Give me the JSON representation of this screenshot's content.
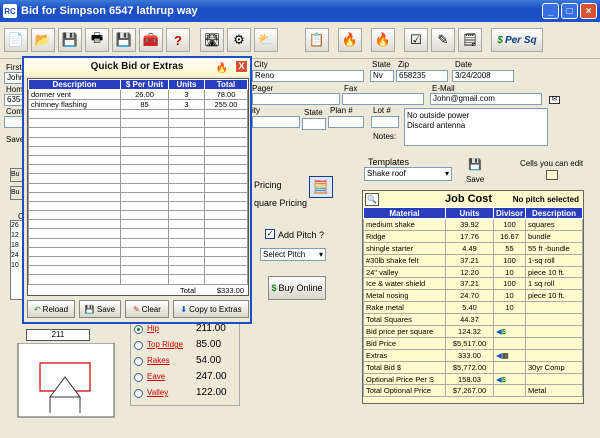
{
  "window": {
    "title": "Bid for Simpson 6547 lathrup way",
    "app_icon": "RC",
    "min_label": "_",
    "max_label": "□",
    "close_label": "×"
  },
  "toolbar": {
    "persq_label": "Per Sq"
  },
  "customer": {
    "city_label": "City",
    "city": "Reno",
    "state_label": "State",
    "state": "Nv",
    "zip_label": "Zip",
    "zip": "658235",
    "date_label": "Date",
    "date": "3/24/2008",
    "pager_label": "Pager",
    "fax_label": "Fax",
    "email_label": "E-Mail",
    "email": "John@gmail.com",
    "city2_label": "ity",
    "state2_label": "State",
    "plan_label": "Plan #",
    "lot_label": "Lot #",
    "notes_label": "Notes:",
    "notes_line1": "No outside power",
    "notes_line2": "Discard antenna",
    "left_first": "First",
    "left_john": "John",
    "left_hom": "Hom",
    "left_635": "635-",
    "left_com": "Com",
    "left_save": "Save"
  },
  "quick_bid": {
    "title": "Quick Bid or Extras",
    "close_label": "X",
    "headers": [
      "Description",
      "$ Per Unit",
      "Units",
      "Total"
    ],
    "rows": [
      [
        "dormer vent",
        "26.00",
        "3",
        "78.00"
      ],
      [
        "chimney flashing",
        "85",
        "3",
        "255.00"
      ]
    ],
    "total_label": "Total",
    "total_value": "$333.00",
    "buttons": {
      "reload": "Reload",
      "save": "Save",
      "clear": "Clear",
      "copy": "Copy to Extras"
    }
  },
  "middle": {
    "pricing": "Pricing",
    "square_pricing": "quare Pricing",
    "add_pitch": "Add Pitch ?",
    "select_pitch": "Select Pitch",
    "buy_online": "Buy Online",
    "bu1": "Bu",
    "bu2": "Bu",
    "c_label": "C",
    "left_nums": [
      "26",
      "12",
      "18",
      "24",
      "10"
    ],
    "box_211": "211"
  },
  "pitch_options": [
    {
      "label": "Hip",
      "value": "211.00",
      "selected": true
    },
    {
      "label": "Top Ridge",
      "value": "85.00",
      "selected": false
    },
    {
      "label": "Rakes",
      "value": "54.00",
      "selected": false
    },
    {
      "label": "Eave",
      "value": "247.00",
      "selected": false
    },
    {
      "label": "Valley",
      "value": "122.00",
      "selected": false
    }
  ],
  "templates": {
    "label": "Templates",
    "selected": "Shake roof",
    "save_label": "Save",
    "cells_edit_label": "Cells you can edit"
  },
  "job_cost": {
    "title": "Job Cost",
    "pitch_note": "No pitch selected",
    "headers": [
      "Material",
      "Units",
      "Divisor",
      "Description"
    ],
    "rows": [
      [
        "medium shake",
        "39.92",
        "100",
        "squares"
      ],
      [
        "Ridge",
        "17.76",
        "16.67",
        "bundle"
      ],
      [
        "shingle starter",
        "4.49",
        "55",
        "55 ft -bundle"
      ],
      [
        "#30lb shake felt",
        "37.21",
        "100",
        "1-sq roll"
      ],
      [
        "24\" valley",
        "12.20",
        "10",
        "piece 10 ft."
      ],
      [
        "Ice & water shield",
        "37.21",
        "100",
        "1 sq roll"
      ],
      [
        "Metal nosing",
        "24.70",
        "10",
        "piece 10 ft."
      ],
      [
        "Rake metal",
        "5.40",
        "10",
        ""
      ]
    ],
    "summary": [
      {
        "label": "Total Squares",
        "value": "44.37",
        "extra": ""
      },
      {
        "label": "Bid price per square",
        "value": "124.32",
        "extra": ""
      },
      {
        "label": "Bid Price",
        "value": "$5,517.00",
        "extra": ""
      },
      {
        "label": "Extras",
        "value": "333.00",
        "extra": ""
      },
      {
        "label": "Total Bid $",
        "value": "$5,772.00",
        "extra": "30yr Comp"
      },
      {
        "label": "Optional Price Per S",
        "value": "158.03",
        "extra": ""
      },
      {
        "label": "Total Optional Price",
        "value": "$7,267.00",
        "extra": "Metal"
      }
    ]
  }
}
